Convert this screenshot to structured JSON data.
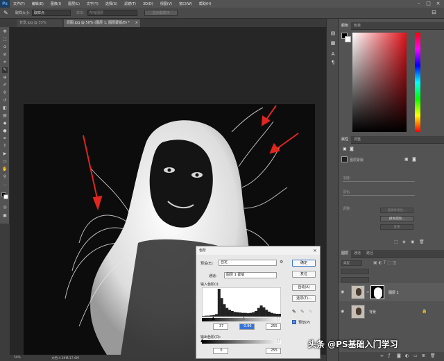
{
  "menubar": {
    "app_logo": "Ps",
    "items": [
      "文件(F)",
      "编辑(E)",
      "图像(I)",
      "图层(L)",
      "文字(Y)",
      "选择(S)",
      "滤镜(T)",
      "3D(D)",
      "视图(V)",
      "窗口(W)",
      "帮助(H)"
    ],
    "window_controls": [
      "–",
      "□",
      "×"
    ]
  },
  "options_bar": {
    "sample_size_label": "取样大小:",
    "sample_size_value": "取样点",
    "sample_label": "样本:",
    "sample_value": "所有图层",
    "show_ring_button": "显示取样环"
  },
  "tabs": [
    {
      "label": "背景.jpg @ 33%(RGB/8#)",
      "close": "×"
    },
    {
      "label": "原图.jpg @ 50% (图层 1, 图层蒙版/8) *",
      "close": "×"
    }
  ],
  "color_panel": {
    "tabs": [
      "颜色",
      "色板"
    ]
  },
  "properties_panel": {
    "tabs": [
      "属性",
      "调整"
    ],
    "mask_label": "图层蒙版",
    "density_label": "浓度:",
    "feather_label": "羽化:",
    "refine_label": "调整:",
    "mask_edge_button": "选择并遮住...",
    "color_range_button": "颜色范围...",
    "invert_button": "反相"
  },
  "levels_dialog": {
    "title": "色阶",
    "preset_label": "预设(E):",
    "preset_value": "自定",
    "channel_label": "通道:",
    "channel_value": "图层 1 蒙版",
    "input_label": "输入色阶(I):",
    "input_black": "37",
    "input_mid": "0.96",
    "input_white": "255",
    "output_label": "输出色阶(O):",
    "output_black": "0",
    "output_white": "255",
    "ok_button": "确定",
    "reset_button": "复位",
    "auto_button": "自动(A)",
    "options_button": "选项(T)...",
    "preview_label": "预览(P)",
    "close_icon": "×"
  },
  "layers_panel": {
    "tabs": [
      "图层",
      "通道",
      "路径"
    ],
    "kind_label": "类型",
    "layer_name_1": "图层 1",
    "layer_name_2": "背景",
    "footer_icons": [
      "link-icon",
      "fx-icon",
      "mask-icon",
      "adjustment-icon",
      "folder-icon",
      "new-layer-icon",
      "trash-icon"
    ]
  },
  "status_bar": {
    "zoom": "50%",
    "doc_info": "文档:4.39M/17.6M"
  },
  "watermark": "头条 @PS基础入门学习",
  "colors": {
    "arrow": "#e0261f",
    "ps_blue": "#58a9f7"
  },
  "histogram": {
    "values": [
      2,
      3,
      3,
      4,
      5,
      8,
      90,
      60,
      40,
      28,
      22,
      18,
      15,
      14,
      13,
      12,
      12,
      11,
      12,
      14,
      18,
      28,
      36,
      30,
      22,
      16,
      12,
      10,
      9,
      9
    ]
  }
}
